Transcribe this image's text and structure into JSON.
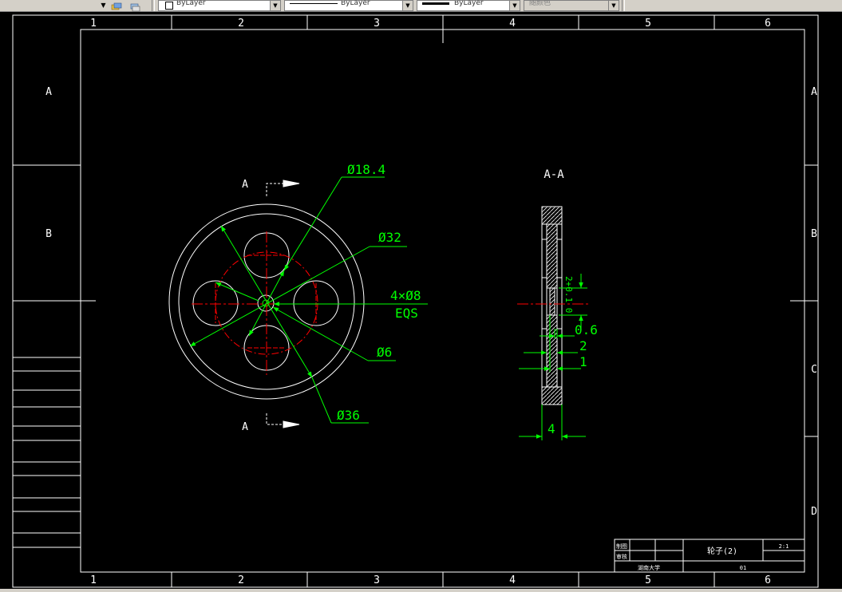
{
  "toolbar": {
    "layer_combo": {
      "value": "ByLayer",
      "swatch": "#ffffff"
    },
    "linetype_combo": {
      "value": "ByLayer"
    },
    "lineweight_combo": {
      "value": "ByLayer"
    },
    "plotstyle_combo": {
      "value": "随颜色"
    }
  },
  "frame": {
    "columns": [
      "1",
      "2",
      "3",
      "4",
      "5",
      "6"
    ],
    "rows": [
      "A",
      "B",
      "C",
      "D"
    ]
  },
  "front_view": {
    "section_label_top": "A",
    "section_label_bottom": "A",
    "dim_d18_4": "Ø18.4",
    "dim_d32": "Ø32",
    "dim_holes": "4×Ø8",
    "dim_eqs": "EQS",
    "dim_d6": "Ø6",
    "dim_d36": "Ø36"
  },
  "section_view": {
    "title": "A-A",
    "dim_2_0": "2+0.1 0",
    "dim_0_6": "0.6",
    "dim_2": "2",
    "dim_1": "1",
    "dim_4": "4"
  },
  "title_block": {
    "part_name": "轮子(2)",
    "scale": "2:1",
    "drawn_label": "制图",
    "checked_label": "审核",
    "school": "湖南大学",
    "sheet": "01"
  },
  "colors": {
    "background": "#000000",
    "outline": "#ffffff",
    "dimension": "#00ff00",
    "centerline": "#ff0000",
    "toolbar": "#d4d0c8"
  }
}
